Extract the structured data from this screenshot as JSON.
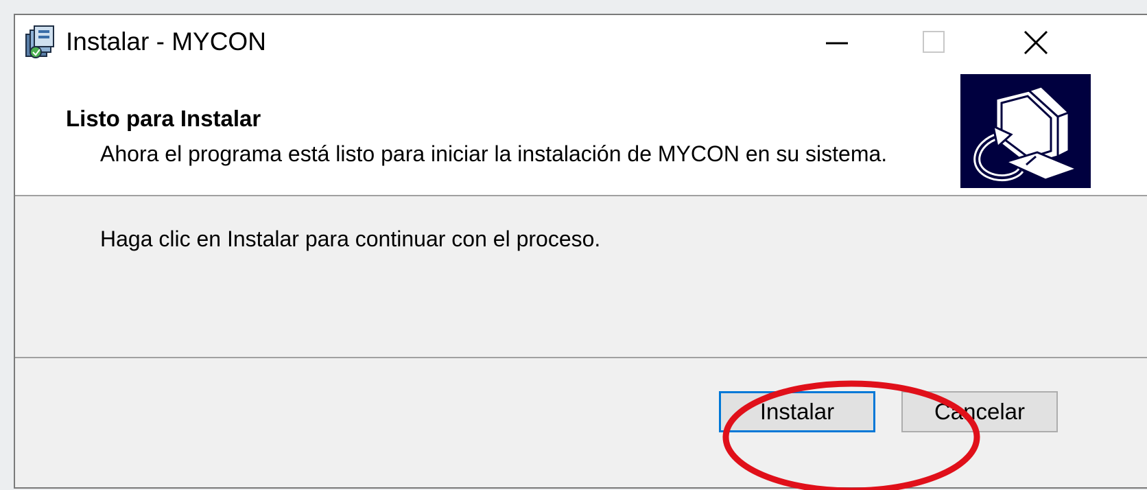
{
  "window": {
    "title": "Instalar - MYCON"
  },
  "header": {
    "title": "Listo para Instalar",
    "subtitle": "Ahora el programa está listo para iniciar la instalación de MYCON en su sistema."
  },
  "body": {
    "instruction": "Haga clic en Instalar para continuar con el proceso."
  },
  "footer": {
    "install_label": "Instalar",
    "cancel_label": "Cancelar"
  },
  "icons": {
    "app": "installer-app-icon",
    "header_image": "computer-install-icon",
    "minimize": "minimize-icon",
    "maximize": "maximize-icon",
    "close": "close-icon"
  },
  "colors": {
    "focus_border": "#0078d7",
    "annotation": "#e0101a",
    "header_image_bg": "#00003f"
  }
}
